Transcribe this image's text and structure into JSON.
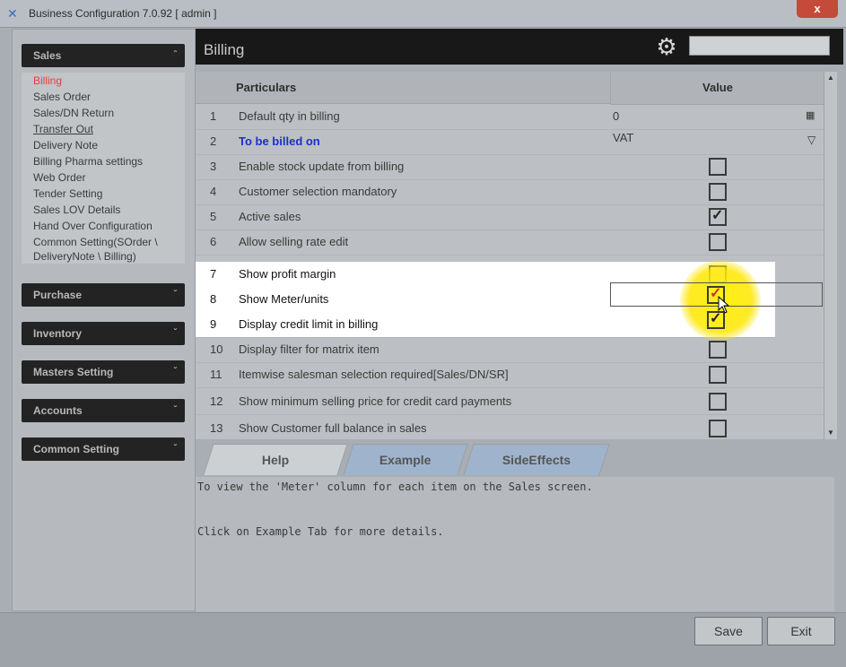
{
  "window": {
    "title": "Business Configuration 7.0.92 [ admin ]",
    "close_label": "x"
  },
  "sidebar": {
    "sales_header": "Sales",
    "sales_items": [
      "Billing",
      "Sales Order",
      "Sales/DN Return",
      "Transfer Out",
      "Delivery Note",
      "Billing Pharma settings",
      "Web Order",
      "Tender Setting",
      "Sales LOV Details",
      "Hand Over Configuration",
      "Common Setting(SOrder \\",
      "DeliveryNote \\ Billing)"
    ],
    "other_headers": [
      "Purchase",
      "Inventory",
      "Masters Setting",
      "Accounts",
      "Common Setting"
    ]
  },
  "main": {
    "title": "Billing"
  },
  "grid": {
    "col_particulars": "Particulars",
    "col_value": "Value",
    "rows": [
      {
        "num": "1",
        "text": "Default qty in  billing",
        "value": "0"
      },
      {
        "num": "2",
        "text": "To be billed on",
        "value": "VAT"
      },
      {
        "num": "3",
        "text": "Enable stock update from billing"
      },
      {
        "num": "4",
        "text": "Customer selection mandatory"
      },
      {
        "num": "5",
        "text": "Active sales"
      },
      {
        "num": "6",
        "text": "Allow selling rate edit"
      },
      {
        "num": "7",
        "text": "Show profit margin"
      },
      {
        "num": "8",
        "text": "Show Meter/units"
      },
      {
        "num": "9",
        "text": "Display credit limit in billing"
      },
      {
        "num": "10",
        "text": "Display filter for matrix item"
      },
      {
        "num": "11",
        "text": "Itemwise salesman selection required[Sales/DN/SR]"
      },
      {
        "num": "12",
        "text": "Show minimum selling price for credit card payments"
      },
      {
        "num": "13",
        "text": "Show Customer full balance in sales"
      }
    ]
  },
  "tabs": {
    "help": "Help",
    "example": "Example",
    "side_effects": "SideEffects"
  },
  "help": {
    "line1": "To view the 'Meter' column for each item on the Sales screen.",
    "line2": "Click on Example Tab for more details."
  },
  "footer": {
    "save_label": "Save",
    "exit_label": "Exit"
  }
}
